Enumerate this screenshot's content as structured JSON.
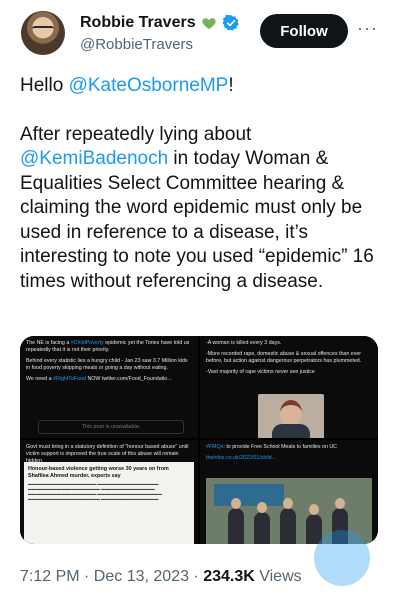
{
  "author": {
    "name": "Robbie Travers",
    "handle": "@RobbieTravers",
    "follow_label": "Follow",
    "more_label": "···"
  },
  "tweet": {
    "greeting_prefix": "Hello ",
    "greeting_mention": "@KateOsborneMP",
    "greeting_suffix": "!",
    "body_1": "After repeatedly lying about ",
    "body_mention": "@KemiBadenoch",
    "body_2": " in today Woman & Equalities Select Committee hearing & claiming the word epidemic must only be used in reference to a disease, it’s interesting to note you used “epidemic” 16 times without referencing a disease."
  },
  "media": {
    "c1": {
      "line1_a": "The NE is facing a ",
      "line1_tag": "#ChildPoverty",
      "line1_b": " epidemic yet the Tories have told us repeatedly that it is not their priority.",
      "line2": "Behind every statistic lies a hungry child - Jan 23 saw 3.7 Million kids in food poverty skipping meals or going a day without eating.",
      "line3_a": "We need a ",
      "line3_tag": "#RightToFood",
      "line3_b": " NOW twitter.com/Food_Foundatio...",
      "unavailable": "This post is unavailable."
    },
    "c2": {
      "line1": "-A woman is killed every 3 days.",
      "line2": "-More recorded rape, domestic abuse & sexual offences than ever before, but action against dangerous perpetrators has plummeted.",
      "line3": "-Vast majority of rape victims never see justice"
    },
    "c3": {
      "line1": "Govt must bring in a statutory definition of \"honour based abuse\" until victim support is improved the true scale of this abuse will remain hidden",
      "headline": "Honour-based violence getting worse 30 years on from Shafilea Ahmed murder, experts say"
    },
    "c4": {
      "line1_tag": "#FMQs",
      "line1_b": ": to provide Free School Meals to families on UC",
      "line2": "theinfos.co.uk/2022/01/child..."
    }
  },
  "meta": {
    "time": "7:12 PM · Dec 13, 2023 · ",
    "views_count": "234.3K",
    "views_label": " Views"
  },
  "colors": {
    "accent": "#1d9bf0",
    "verified": "#1d9bf0",
    "heart": "#78b159",
    "text": "#0f1419",
    "muted": "#536471"
  }
}
